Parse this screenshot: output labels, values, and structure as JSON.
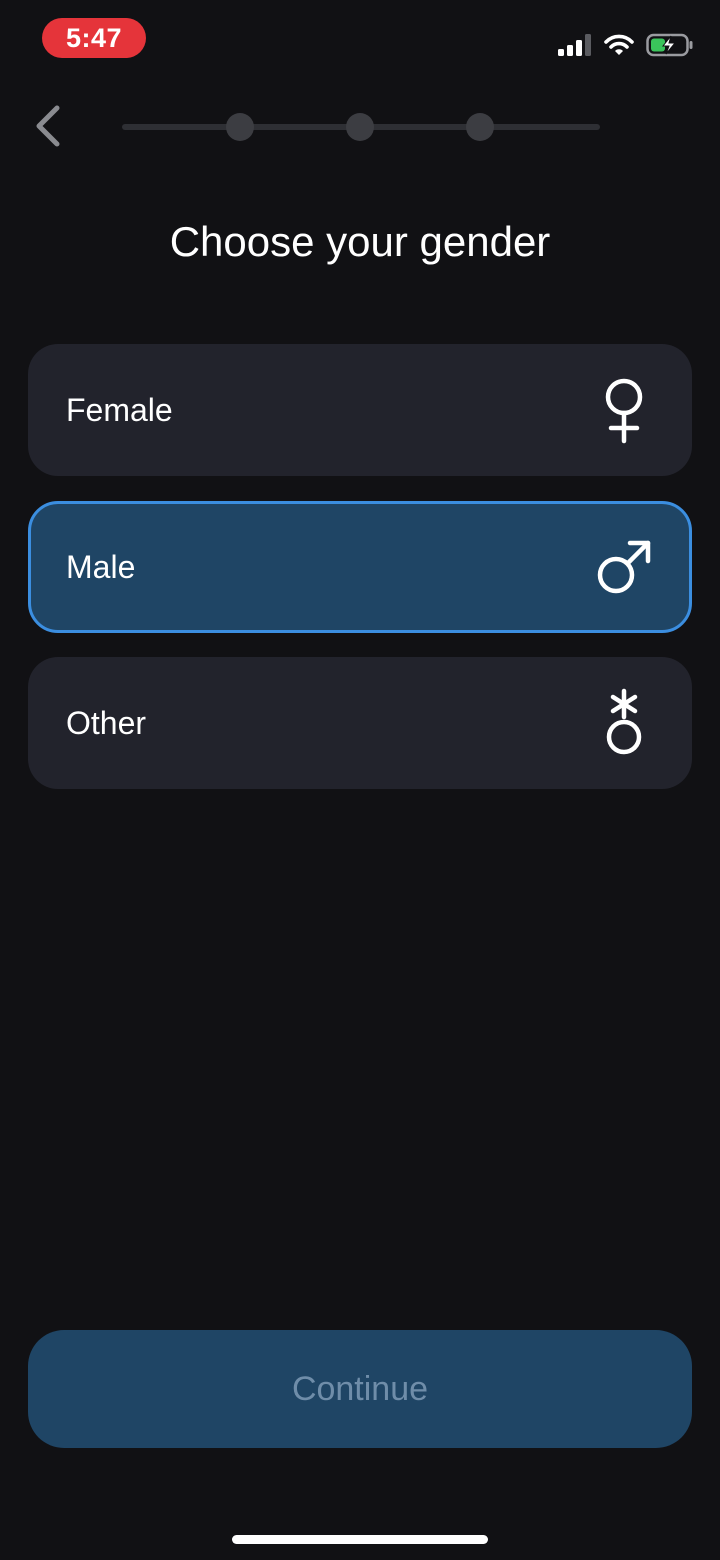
{
  "status_bar": {
    "time": "5:47",
    "time_pill_color": "#e5343a",
    "icons": [
      "cellular-signal-icon",
      "wifi-icon",
      "battery-charging-icon"
    ]
  },
  "nav": {
    "back_icon": "chevron-left-icon",
    "progress_steps": 3
  },
  "page": {
    "title": "Choose your gender"
  },
  "options": [
    {
      "label": "Female",
      "icon": "female-symbol-icon",
      "selected": false
    },
    {
      "label": "Male",
      "icon": "male-symbol-icon",
      "selected": true
    },
    {
      "label": "Other",
      "icon": "other-gender-symbol-icon",
      "selected": false
    }
  ],
  "continue_button": {
    "label": "Continue"
  },
  "colors": {
    "background": "#111114",
    "card": "#22232c",
    "selected_card": "#1f4565",
    "selected_border": "#3b8ee0",
    "button_text_disabled": "#6f8da9"
  }
}
